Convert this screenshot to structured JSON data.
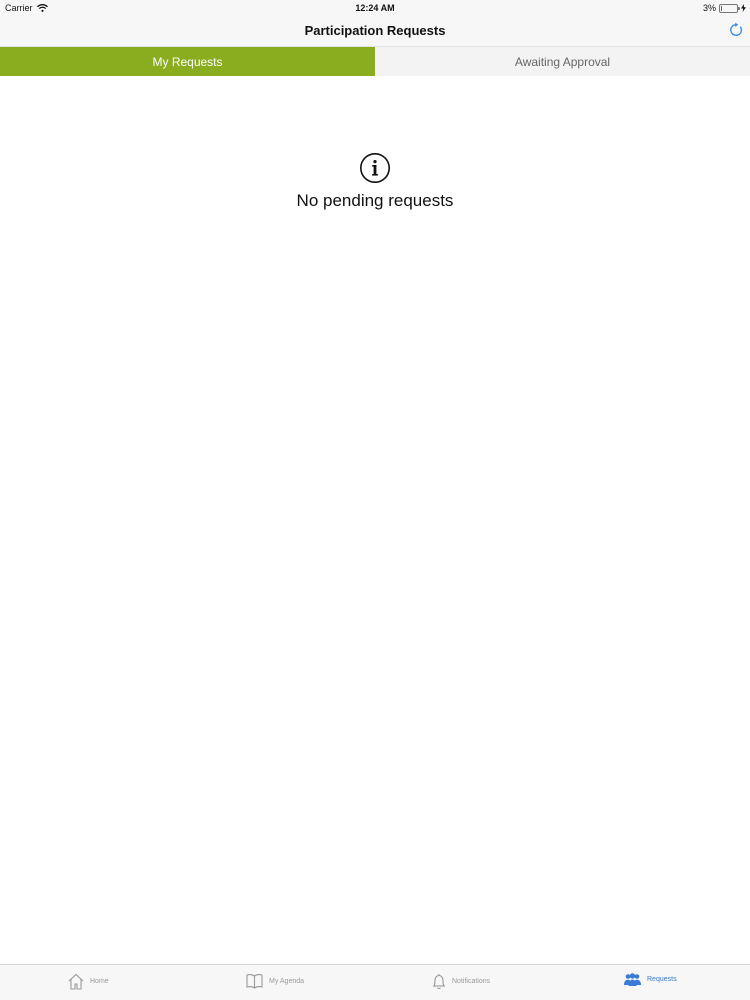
{
  "status_bar": {
    "carrier": "Carrier",
    "time": "12:24 AM",
    "battery": "3%"
  },
  "nav_bar": {
    "title": "Participation Requests",
    "refresh_icon": "refresh-icon"
  },
  "tabs": [
    {
      "label": "My Requests",
      "active": true
    },
    {
      "label": "Awaiting Approval",
      "active": false
    }
  ],
  "empty_state": {
    "icon": "info-icon",
    "message": "No pending requests"
  },
  "tab_bar": {
    "items": [
      {
        "label": "Home",
        "icon": "home-icon",
        "active": false
      },
      {
        "label": "My Agenda",
        "icon": "book-icon",
        "active": false
      },
      {
        "label": "Notifications",
        "icon": "bell-icon",
        "active": false
      },
      {
        "label": "Requests",
        "icon": "people-icon",
        "active": true
      }
    ]
  },
  "colors": {
    "accent_green": "#8aad1f",
    "active_blue": "#3a7bd5",
    "inactive_gray": "#9a9a9a"
  }
}
